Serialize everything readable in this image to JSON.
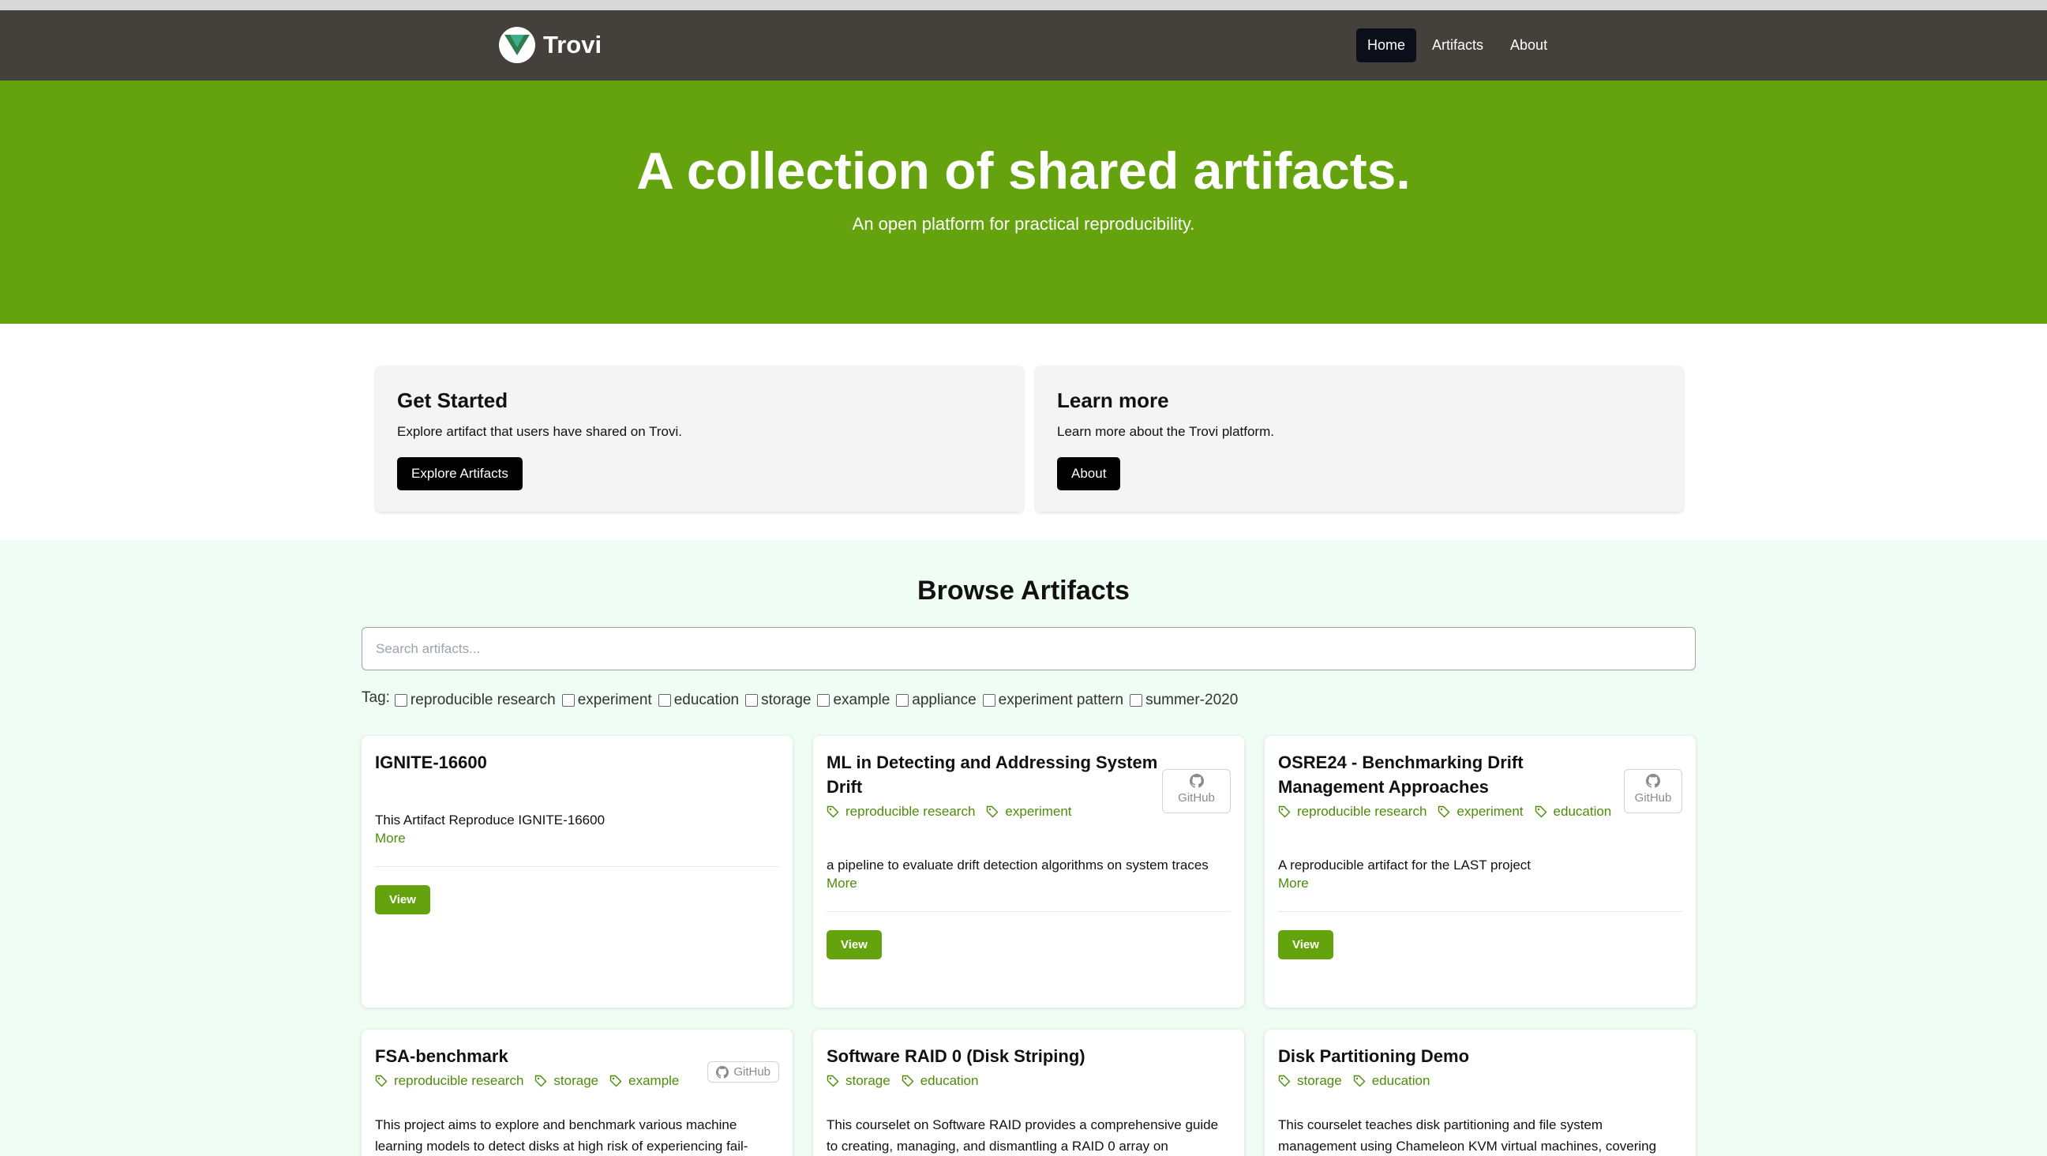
{
  "nav": {
    "brand": "Trovi",
    "links": [
      "Home",
      "Artifacts",
      "About"
    ]
  },
  "hero": {
    "title": "A collection of shared artifacts.",
    "subtitle": "An open platform for practical reproducibility."
  },
  "intro": {
    "get_started": {
      "title": "Get Started",
      "text": "Explore artifact that users have shared on Trovi.",
      "button": "Explore Artifacts"
    },
    "learn_more": {
      "title": "Learn more",
      "text": "Learn more about the Trovi platform.",
      "button": "About"
    }
  },
  "browse": {
    "title": "Browse Artifacts",
    "search_placeholder": "Search artifacts...",
    "tag_label": "Tag:",
    "tags": [
      "reproducible research",
      "experiment",
      "education",
      "storage",
      "example",
      "appliance",
      "experiment pattern",
      "summer-2020"
    ]
  },
  "artifacts": [
    {
      "title": "IGNITE-16600",
      "tags": [],
      "description": "This Artifact Reproduce IGNITE-16600",
      "more": "More",
      "view": "View"
    },
    {
      "title": "ML in Detecting and Addressing System Drift",
      "tags": [
        "reproducible research",
        "experiment"
      ],
      "github": "GitHub",
      "description": "a pipeline to evaluate drift detection algorithms on system traces",
      "more": "More",
      "view": "View"
    },
    {
      "title": "OSRE24 - Benchmarking Drift Management Approaches",
      "tags": [
        "reproducible research",
        "experiment",
        "education"
      ],
      "github": "GitHub",
      "description": "A reproducible artifact for the LAST project",
      "more": "More",
      "view": "View"
    },
    {
      "title": "FSA-benchmark",
      "tags": [
        "reproducible research",
        "storage",
        "example"
      ],
      "github": "GitHub",
      "description": "This project aims to explore and benchmark various machine learning models to detect disks at high risk of experiencing fail-"
    },
    {
      "title": "Software RAID 0 (Disk Striping)",
      "tags": [
        "storage",
        "education"
      ],
      "description": "This courselet on Software RAID provides a comprehensive guide to creating, managing, and dismantling a RAID 0 array on"
    },
    {
      "title": "Disk Partitioning Demo",
      "tags": [
        "storage",
        "education"
      ],
      "description": "This courselet teaches disk partitioning and file system management using Chameleon KVM virtual machines, covering"
    }
  ]
}
